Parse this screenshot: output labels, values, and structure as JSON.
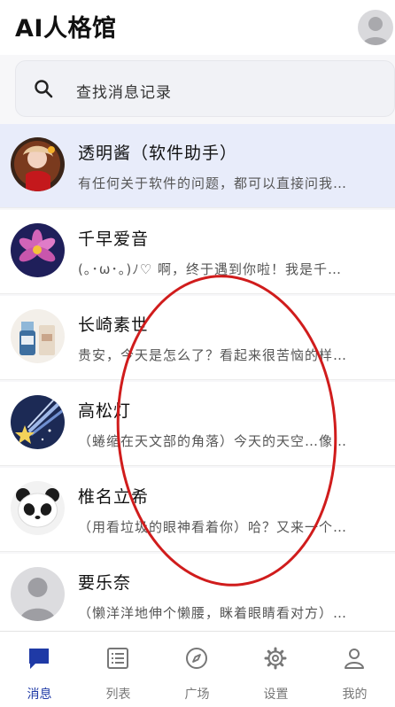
{
  "header": {
    "title": "AI人格馆"
  },
  "search": {
    "placeholder": "查找消息记录"
  },
  "chats": [
    {
      "name": "透明酱（软件助手）",
      "preview": "有任何关于软件的问题，都可以直接问我…"
    },
    {
      "name": "千早爱音",
      "preview": "(｡･ω･｡)ﾉ♡ 啊，终于遇到你啦！我是千…"
    },
    {
      "name": "长崎素世",
      "preview": "贵安，今天是怎么了？看起来很苦恼的样…"
    },
    {
      "name": "高松灯",
      "preview": "（蜷缩在天文部的角落）今天的天空…像…"
    },
    {
      "name": "椎名立希",
      "preview": "（用看垃圾的眼神看着你）哈？又来一个…"
    },
    {
      "name": "要乐奈",
      "preview": "（懒洋洋地伸个懒腰，眯着眼睛看对方）…"
    }
  ],
  "nav": [
    {
      "label": "消息",
      "icon": "chat-bubble-icon",
      "active": true
    },
    {
      "label": "列表",
      "icon": "list-icon"
    },
    {
      "label": "广场",
      "icon": "compass-icon"
    },
    {
      "label": "设置",
      "icon": "gear-icon"
    },
    {
      "label": "我的",
      "icon": "person-icon"
    }
  ],
  "colors": {
    "accent": "#1f3aa6",
    "selected_row": "#e8ecfa",
    "annotation": "#d01c1c"
  }
}
